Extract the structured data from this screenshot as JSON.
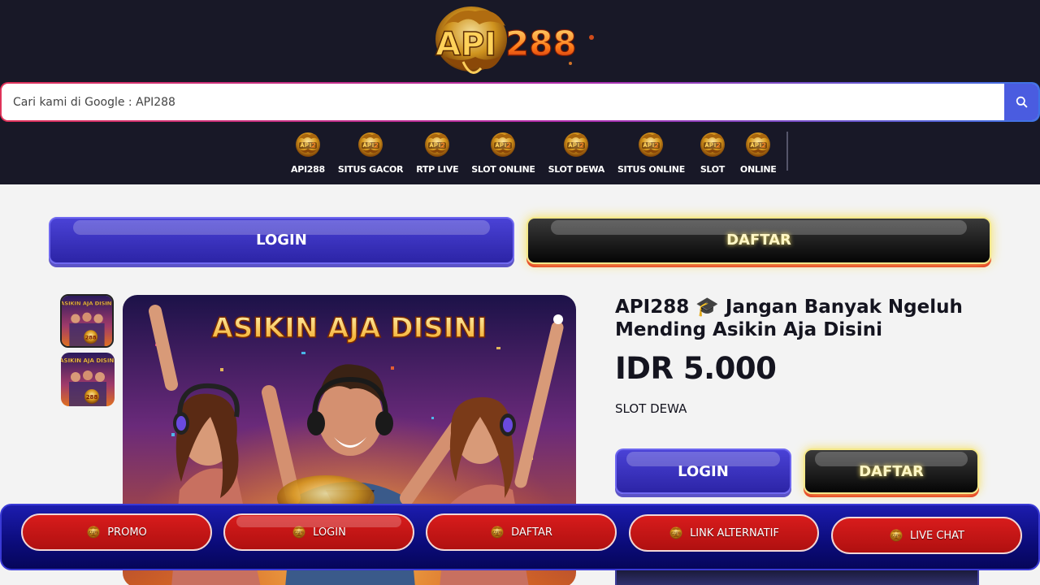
{
  "brand": {
    "logo_text": "API288"
  },
  "search": {
    "placeholder": "Cari kami di Google : API288"
  },
  "nav": {
    "items": [
      {
        "label": "API288"
      },
      {
        "label": "SITUS GACOR"
      },
      {
        "label": "RTP LIVE"
      },
      {
        "label": "SLOT ONLINE"
      },
      {
        "label": "SLOT DEWA"
      },
      {
        "label": "SITUS ONLINE"
      },
      {
        "label": "SLOT"
      },
      {
        "label": "ONLINE"
      }
    ]
  },
  "cta": {
    "login_label": "LOGIN",
    "daftar_label": "DAFTAR"
  },
  "gallery": {
    "banner_text": "ASIKIN AJA DISINI",
    "thumb_brand": "API288"
  },
  "product": {
    "title": "API288 🎓 Jangan Banyak Ngeluh Mending Asikin Aja Disini",
    "price": "IDR 5.000",
    "category": "SLOT DEWA",
    "login_label": "LOGIN",
    "daftar_label": "DAFTAR"
  },
  "bottom_bar": {
    "items": [
      {
        "label": "PROMO"
      },
      {
        "label": "LOGIN"
      },
      {
        "label": "DAFTAR"
      },
      {
        "label": "LINK ALTERNATIF"
      },
      {
        "label": "LIVE CHAT"
      }
    ]
  },
  "colors": {
    "header_bg": "#181827",
    "page_bg": "#f3f3f3",
    "login_blue": "#2c24a6",
    "daftar_black": "#050505",
    "accent_red": "#c21414",
    "search_button": "#4a5ce0"
  },
  "icons": {
    "search": "search-icon",
    "nav": "dragon-emblem-icon",
    "bottom": "dragon-emblem-icon"
  }
}
